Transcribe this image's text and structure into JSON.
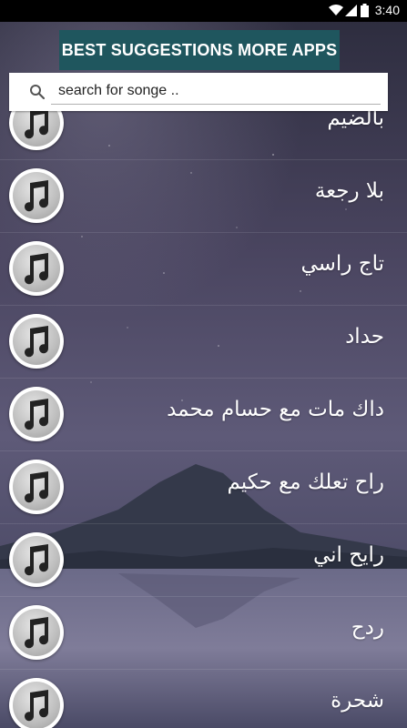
{
  "status_bar": {
    "time": "3:40"
  },
  "banner": {
    "label": "BEST SUGGESTIONS MORE APPS"
  },
  "search": {
    "placeholder": "search for songe ..",
    "value": ""
  },
  "songs": [
    "بالضيم",
    "بلا رجعة",
    "تاج راسي",
    "حداد",
    "داك مات مع حسام محمد",
    "راح تعلك مع حكيم",
    "رايح اني",
    "ردح",
    "شحرة"
  ]
}
